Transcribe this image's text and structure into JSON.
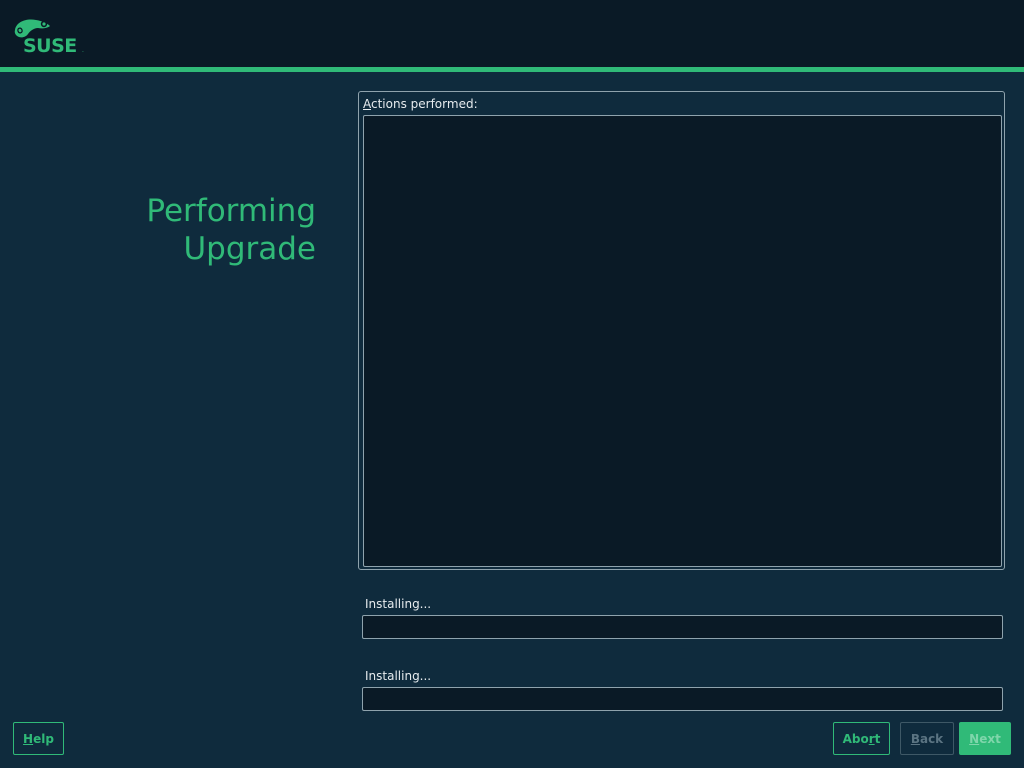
{
  "header": {
    "logo_text": "SUSE",
    "brand_color": "#30ba78",
    "background": "#0a1a26"
  },
  "page": {
    "title_line1": "Performing",
    "title_line2": "Upgrade"
  },
  "log": {
    "label_mnemonic": "A",
    "label_rest": "ctions performed:",
    "content": ""
  },
  "progress": [
    {
      "label": "Installing...",
      "value": 0
    },
    {
      "label": "Installing...",
      "value": 0
    }
  ],
  "buttons": {
    "help": {
      "mnemonic": "H",
      "rest": "elp",
      "enabled": true
    },
    "abort": {
      "pre": "Abo",
      "mnemonic": "r",
      "rest": "t",
      "enabled": true
    },
    "back": {
      "mnemonic": "B",
      "rest": "ack",
      "enabled": false
    },
    "next": {
      "mnemonic": "N",
      "rest": "ext",
      "enabled": false
    }
  },
  "icons": {
    "logo": "suse-chameleon-logo"
  }
}
